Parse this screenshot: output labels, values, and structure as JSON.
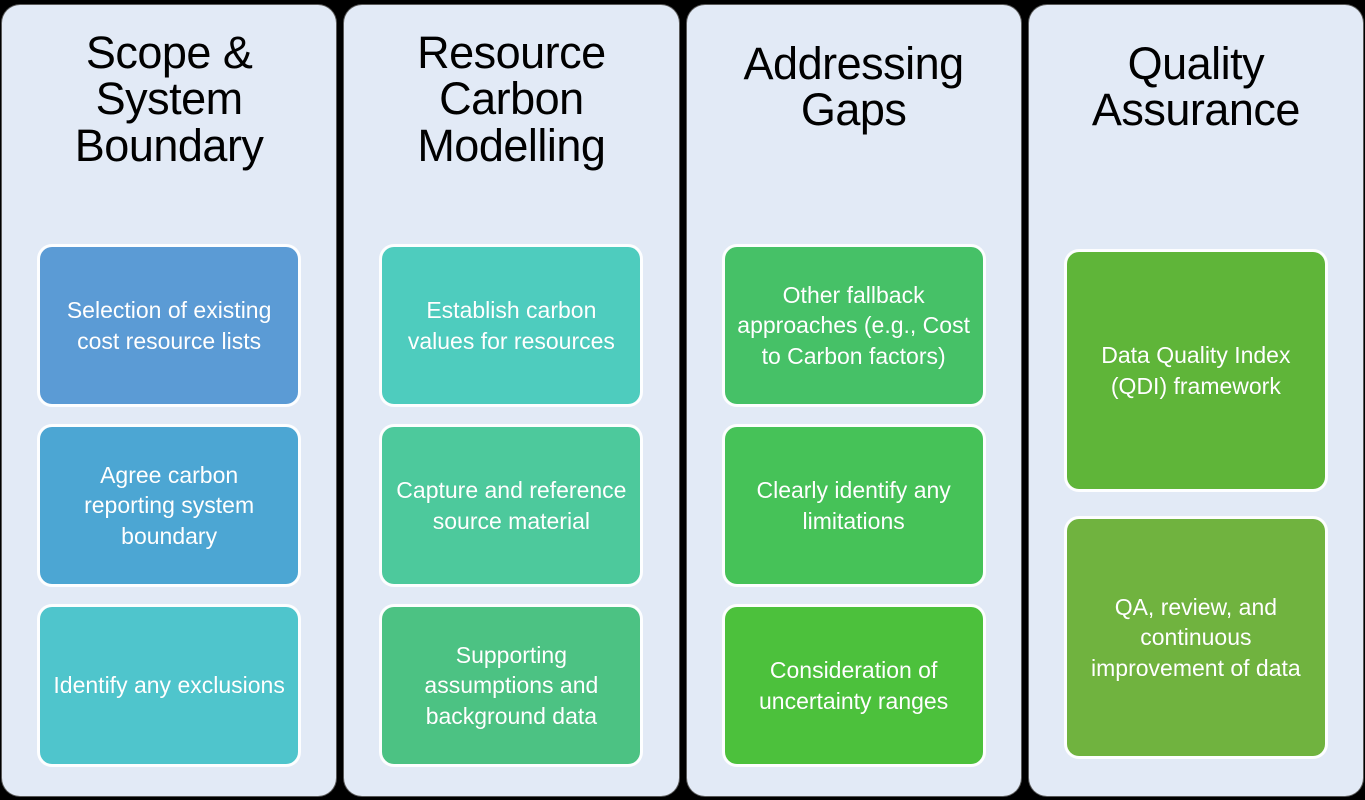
{
  "diagram": {
    "background_color": "#000000",
    "panel_color": "#E2EAF6",
    "columns": [
      {
        "id": "scope-system-boundary",
        "title": "Scope & System Boundary",
        "cards": [
          {
            "label": "Selection of existing cost resource lists",
            "color": "#5B9BD5"
          },
          {
            "label": "Agree carbon reporting system boundary",
            "color": "#4CA6D3"
          },
          {
            "label": "Identify any exclusions",
            "color": "#4FC5CC"
          }
        ]
      },
      {
        "id": "resource-carbon-modelling",
        "title": "Resource Carbon Modelling",
        "cards": [
          {
            "label": "Establish carbon values for resources",
            "color": "#4ECCBE"
          },
          {
            "label": "Capture and reference source material",
            "color": "#4DC99C"
          },
          {
            "label": "Supporting assumptions and background data",
            "color": "#4CC283"
          }
        ]
      },
      {
        "id": "addressing-gaps",
        "title": "Addressing Gaps",
        "cards": [
          {
            "label": "Other fallback approaches (e.g., Cost to Carbon factors)",
            "color": "#46C167"
          },
          {
            "label": "Clearly identify any limitations",
            "color": "#46C258"
          },
          {
            "label": "Consideration of uncertainty ranges",
            "color": "#4CC13C"
          }
        ]
      },
      {
        "id": "quality-assurance",
        "title": "Quality Assurance",
        "cards": [
          {
            "label": "Data Quality Index (QDI) framework",
            "color": "#5FB539"
          },
          {
            "label": "QA, review, and continuous improvement of data",
            "color": "#70B33F"
          }
        ]
      }
    ]
  }
}
